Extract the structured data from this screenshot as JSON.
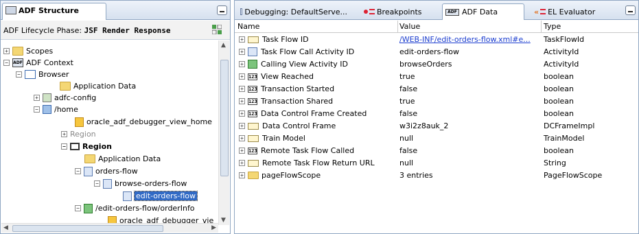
{
  "left_panel": {
    "tab_title": "ADF Structure",
    "phase_label": "ADF Lifecycle Phase:",
    "phase_value": "JSF Render Response",
    "tree": [
      {
        "label": "Scopes",
        "exp": "+",
        "icon": "folder-icon"
      },
      {
        "label": "ADF Context",
        "exp": "−",
        "icon": "adf-icon"
      },
      {
        "label": "Browser",
        "exp": "−",
        "icon": "browser-icon"
      },
      {
        "label": "Application Data",
        "exp": "",
        "icon": "folder-icon"
      },
      {
        "label": "adfc-config",
        "exp": "+",
        "icon": "config-icon"
      },
      {
        "label": "/home",
        "exp": "−",
        "icon": "page-icon"
      },
      {
        "label": "oracle_adf_debugger_view_home",
        "exp": "",
        "icon": "view-icon"
      },
      {
        "label": "Region",
        "exp": "+",
        "icon": "region-grey-icon"
      },
      {
        "label": "Region",
        "exp": "−",
        "icon": "region-icon"
      },
      {
        "label": "Application Data",
        "exp": "",
        "icon": "folder-icon"
      },
      {
        "label": "orders-flow",
        "exp": "−",
        "icon": "taskflow-icon"
      },
      {
        "label": "browse-orders-flow",
        "exp": "−",
        "icon": "taskflow-icon"
      },
      {
        "label": "edit-orders-flow",
        "exp": "",
        "icon": "taskflow-icon"
      },
      {
        "label": "/edit-orders-flow/orderInfo",
        "exp": "−",
        "icon": "activity-icon"
      },
      {
        "label": "oracle_adf_debugger_vie",
        "exp": "",
        "icon": "view-icon"
      }
    ]
  },
  "right_panel": {
    "tabs": [
      {
        "label": "Debugging: DefaultServe...",
        "icon": "debug-icon"
      },
      {
        "label": "Breakpoints",
        "icon": "breakpoints-icon"
      },
      {
        "label": "ADF Data",
        "icon": "adf-data-icon"
      },
      {
        "label": "EL Evaluator",
        "icon": "el-evaluator-icon"
      }
    ],
    "columns": [
      "Name",
      "Value",
      "Type"
    ],
    "rows": [
      {
        "name": "Task Flow ID",
        "value": "/WEB-INF/edit-orders-flow.xml#e...",
        "type": "TaskFlowId",
        "icon": "object-icon",
        "link": true
      },
      {
        "name": "Task Flow Call Activity ID",
        "value": "edit-orders-flow",
        "type": "ActivityId",
        "icon": "taskflow-call-icon"
      },
      {
        "name": "Calling View Activity ID",
        "value": "browseOrders",
        "type": "ActivityId",
        "icon": "view-activity-icon"
      },
      {
        "name": "View Reached",
        "value": "true",
        "type": "boolean",
        "icon": "123-icon"
      },
      {
        "name": "Transaction Started",
        "value": "false",
        "type": "boolean",
        "icon": "123-icon"
      },
      {
        "name": "Transaction Shared",
        "value": "true",
        "type": "boolean",
        "icon": "123-icon"
      },
      {
        "name": "Data Control Frame Created",
        "value": "false",
        "type": "boolean",
        "icon": "123-icon"
      },
      {
        "name": "Data Control Frame",
        "value": "w3i2z8auk_2",
        "type": "DCFrameImpl",
        "icon": "object-icon"
      },
      {
        "name": "Train Model",
        "value": "null",
        "type": "TrainModel",
        "icon": "object-icon"
      },
      {
        "name": "Remote Task Flow Called",
        "value": "false",
        "type": "boolean",
        "icon": "123-icon"
      },
      {
        "name": "Remote Task Flow Return URL",
        "value": "null",
        "type": "String",
        "icon": "object-icon"
      },
      {
        "name": "pageFlowScope",
        "value": "3 entries",
        "type": "PageFlowScope",
        "icon": "folder-icon"
      }
    ]
  },
  "icon_text": {
    "num": "123",
    "adf": "ADF"
  },
  "colors": {
    "selection": "#316ac5",
    "link": "#1a3ccf",
    "folder": "#f4d774",
    "panel_border": "#8fa6c2"
  }
}
